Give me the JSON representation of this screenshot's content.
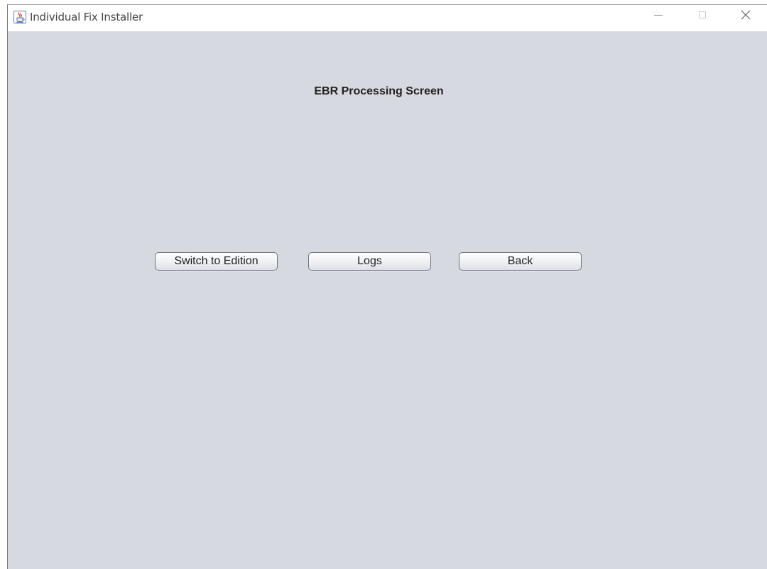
{
  "window": {
    "title": "Individual Fix  Installer",
    "app_icon": "java-cup-icon",
    "controls": {
      "minimize_icon": "minimize-icon",
      "maximize_icon": "maximize-icon",
      "close_icon": "close-icon"
    }
  },
  "screen": {
    "heading": "EBR Processing Screen",
    "buttons": {
      "switch_label": "Switch to Edition",
      "logs_label": "Logs",
      "back_label": "Back"
    }
  },
  "colors": {
    "client_background": "#d6d9e0",
    "titlebar_background": "#ffffff",
    "button_border": "#6f7680"
  }
}
